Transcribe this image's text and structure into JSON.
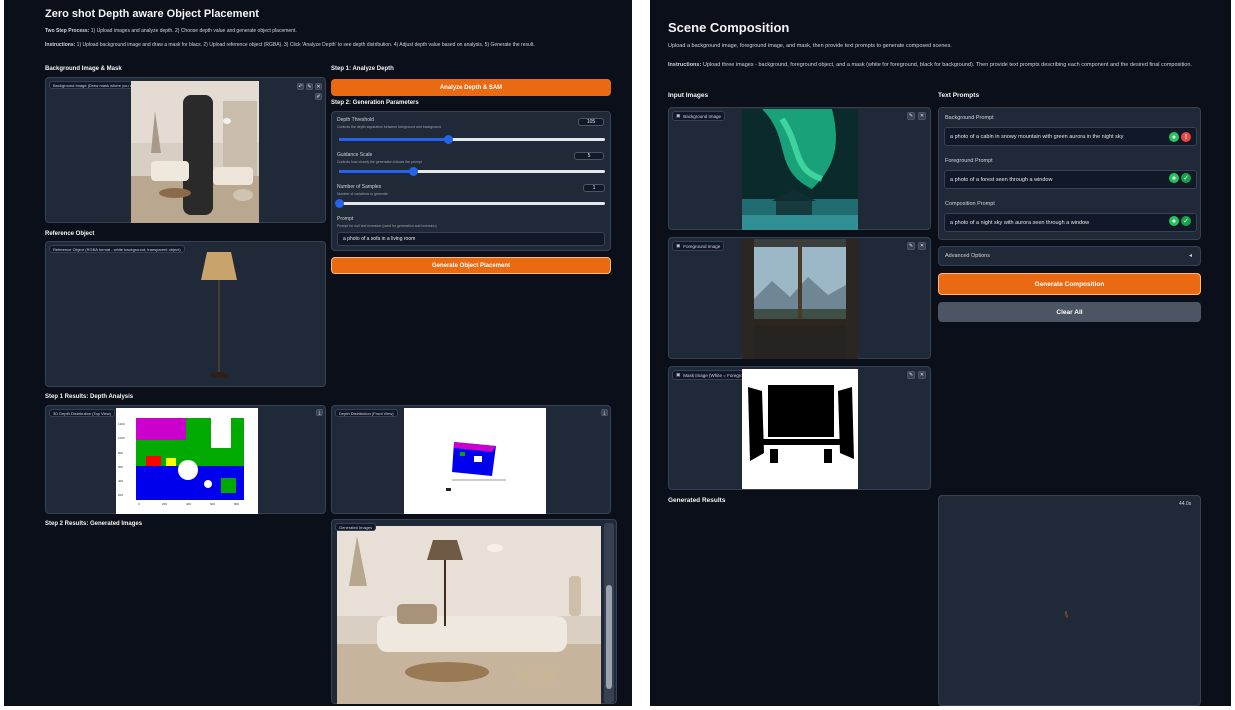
{
  "left": {
    "title": "Zero shot Depth aware Object Placement",
    "two_step_label": "Two Step Process:",
    "two_step_text": "1) Upload images and analyze depth. 2) Choose depth value and generate object placement.",
    "instructions_label": "Instructions:",
    "instructions_text": "1) Upload background image and draw a mask for blacs. 2) Upload reference object (RGBA). 3) Click 'Analyze Depth' to see depth distribution. 4) Adjust depth value based on analysis. 5) Generate the result.",
    "bg_section": "Background Image & Mask",
    "bg_image_label": "Background Image (Draw mask where you want to place object preferably a box)",
    "ref_section": "Reference Object",
    "ref_image_label": "Reference Object (RGBA format - white background, transparent object)",
    "step1_header": "Step 1: Analyze Depth",
    "analyze_button": "Analyze Depth & SAM",
    "step2_header": "Step 2: Generation Parameters",
    "depth_threshold": {
      "label": "Depth Threshold",
      "desc": "Controls the depth separation between foreground and background",
      "value": "105",
      "fraction": 0.41
    },
    "guidance_scale": {
      "label": "Guidance Scale",
      "desc": "Controls how closely the generation follows the prompt",
      "value": "5",
      "fraction": 0.28
    },
    "num_samples": {
      "label": "Number of Samples",
      "desc": "Number of variations to generate",
      "value": "1",
      "fraction": 0.0
    },
    "prompt": {
      "label": "Prompt",
      "desc": "Prompt for null text inversion (used for generation and inversion)",
      "value": "a photo of a sofa in a living room"
    },
    "generate_button": "Generate Object Placement",
    "results1_header": "Step 1 Results: Depth Analysis",
    "depth_top_label": "3D Depth Distribution (Top View)",
    "depth_front_label": "Depth Distribution (Front View)",
    "results2_header": "Step 2 Results: Generated Images",
    "generated_label": "Generated Images",
    "ticks_y": [
      "1200",
      "1000",
      "800",
      "600",
      "400",
      "200"
    ],
    "ticks_x": [
      "0",
      "200",
      "400",
      "600",
      "800"
    ]
  },
  "right": {
    "title": "Scene Composition",
    "intro": "Upload a background image, foreground image, and mask, then provide text prompts to generate composed scenes.",
    "instructions_label": "Instructions:",
    "instructions_text": "Upload three images - background, foreground object, and a mask (white for foreground, black for background). Then provide text prompts describing each component and the desired final composition.",
    "input_images_header": "Input Images",
    "text_prompts_header": "Text Prompts",
    "bg_image_label": "Background Image",
    "fg_image_label": "Foreground Image",
    "mask_image_label": "Mask Image (White = Foreground, Black = Background)",
    "bg_prompt_label": "Background Prompt",
    "bg_prompt_value": "a photo of a cabin in snowy mountain with green aurora in the night sky",
    "fg_prompt_label": "Foreground Prompt",
    "fg_prompt_value": "a photo of a forest seen through a window",
    "comp_prompt_label": "Composition Prompt",
    "comp_prompt_value": "a photo of a night sky with aurora seen through a window",
    "advanced_options": "Advanced Options",
    "generate_button": "Generate Composition",
    "clear_button": "Clear All",
    "results_header": "Generated Results",
    "timer": "44.0s"
  },
  "icons": {
    "image": "image-icon",
    "edit": "pencil-icon",
    "close": "close-icon",
    "toggle": "triangle-left-icon"
  },
  "colors": {
    "accent": "#ea6a13",
    "background": "#0b0f19",
    "block": "#1f2937",
    "slider": "#2563eb"
  }
}
